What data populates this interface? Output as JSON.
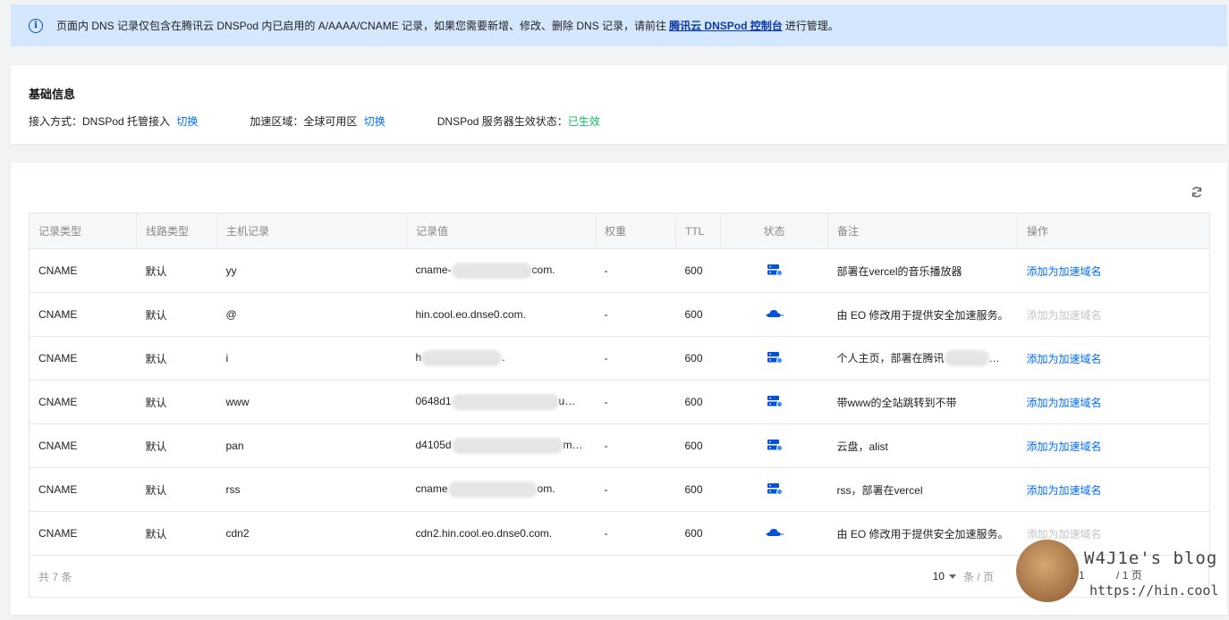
{
  "notice": {
    "text_before": "页面内 DNS 记录仅包含在腾讯云 DNSPod 内已启用的 A/AAAA/CNAME 记录，如果您需要新增、修改、删除 DNS 记录，请前往",
    "link": "腾讯云 DNSPod 控制台",
    "text_after": "进行管理。"
  },
  "basic": {
    "title": "基础信息",
    "access_label": "接入方式：DNSPod 托管接入",
    "access_switch": "切换",
    "region_label": "加速区域：全球可用区",
    "region_switch": "切换",
    "server_label": "DNSPod 服务器生效状态：",
    "server_status": "已生效"
  },
  "table": {
    "headers": [
      "记录类型",
      "线路类型",
      "主机记录",
      "记录值",
      "权重",
      "TTL",
      "状态",
      "备注",
      "操作"
    ],
    "rows": [
      {
        "type": "CNAME",
        "line": "默认",
        "host": "yy",
        "value_prefix": "cname-",
        "value_suffix": "com.",
        "weight": "-",
        "ttl": "600",
        "status_icon": "server-icon",
        "remark": "部署在vercel的音乐播放器",
        "op": "添加为加速域名",
        "op_disabled": false
      },
      {
        "type": "CNAME",
        "line": "默认",
        "host": "@",
        "value_prefix": "hin.cool.eo.dnse0.com.",
        "value_suffix": "",
        "weight": "-",
        "ttl": "600",
        "status_icon": "cloud-icon",
        "remark": "由 EO 修改用于提供安全加速服务。",
        "op": "添加为加速域名",
        "op_disabled": true
      },
      {
        "type": "CNAME",
        "line": "默认",
        "host": "i",
        "value_prefix": "h",
        "value_suffix": ".",
        "weight": "-",
        "ttl": "600",
        "status_icon": "server-icon",
        "remark": "个人主页，部署在腾讯",
        "remark_suffix": "…",
        "op": "添加为加速域名",
        "op_disabled": false
      },
      {
        "type": "CNAME",
        "line": "默认",
        "host": "www",
        "value_prefix": "0648d1",
        "value_suffix": "u…",
        "weight": "-",
        "ttl": "600",
        "status_icon": "server-icon",
        "remark": "带www的全站跳转到不带",
        "op": "添加为加速域名",
        "op_disabled": false
      },
      {
        "type": "CNAME",
        "line": "默认",
        "host": "pan",
        "value_prefix": "d4105d",
        "value_suffix": "m…",
        "weight": "-",
        "ttl": "600",
        "status_icon": "server-icon",
        "remark": "云盘，alist",
        "op": "添加为加速域名",
        "op_disabled": false
      },
      {
        "type": "CNAME",
        "line": "默认",
        "host": "rss",
        "value_prefix": "cname",
        "value_suffix": "om.",
        "weight": "-",
        "ttl": "600",
        "status_icon": "server-icon",
        "remark": "rss，部署在vercel",
        "op": "添加为加速域名",
        "op_disabled": false
      },
      {
        "type": "CNAME",
        "line": "默认",
        "host": "cdn2",
        "value_prefix": "cdn2.hin.cool.eo.dnse0.com.",
        "value_suffix": "",
        "weight": "-",
        "ttl": "600",
        "status_icon": "cloud-icon",
        "remark": "由 EO 修改用于提供安全加速服务。",
        "op": "添加为加速域名",
        "op_disabled": true
      }
    ]
  },
  "footer": {
    "total": "共 7 条",
    "page_size": "10",
    "page_size_unit": "条 / 页",
    "page_current": "1",
    "page_total": "/ 1 页"
  },
  "watermark": {
    "title": "W4J1e's blog",
    "url": "https://hin.cool"
  },
  "colors": {
    "accent": "#006eff",
    "success": "#0abf5b",
    "notice_bg": "#d5e7fd"
  }
}
